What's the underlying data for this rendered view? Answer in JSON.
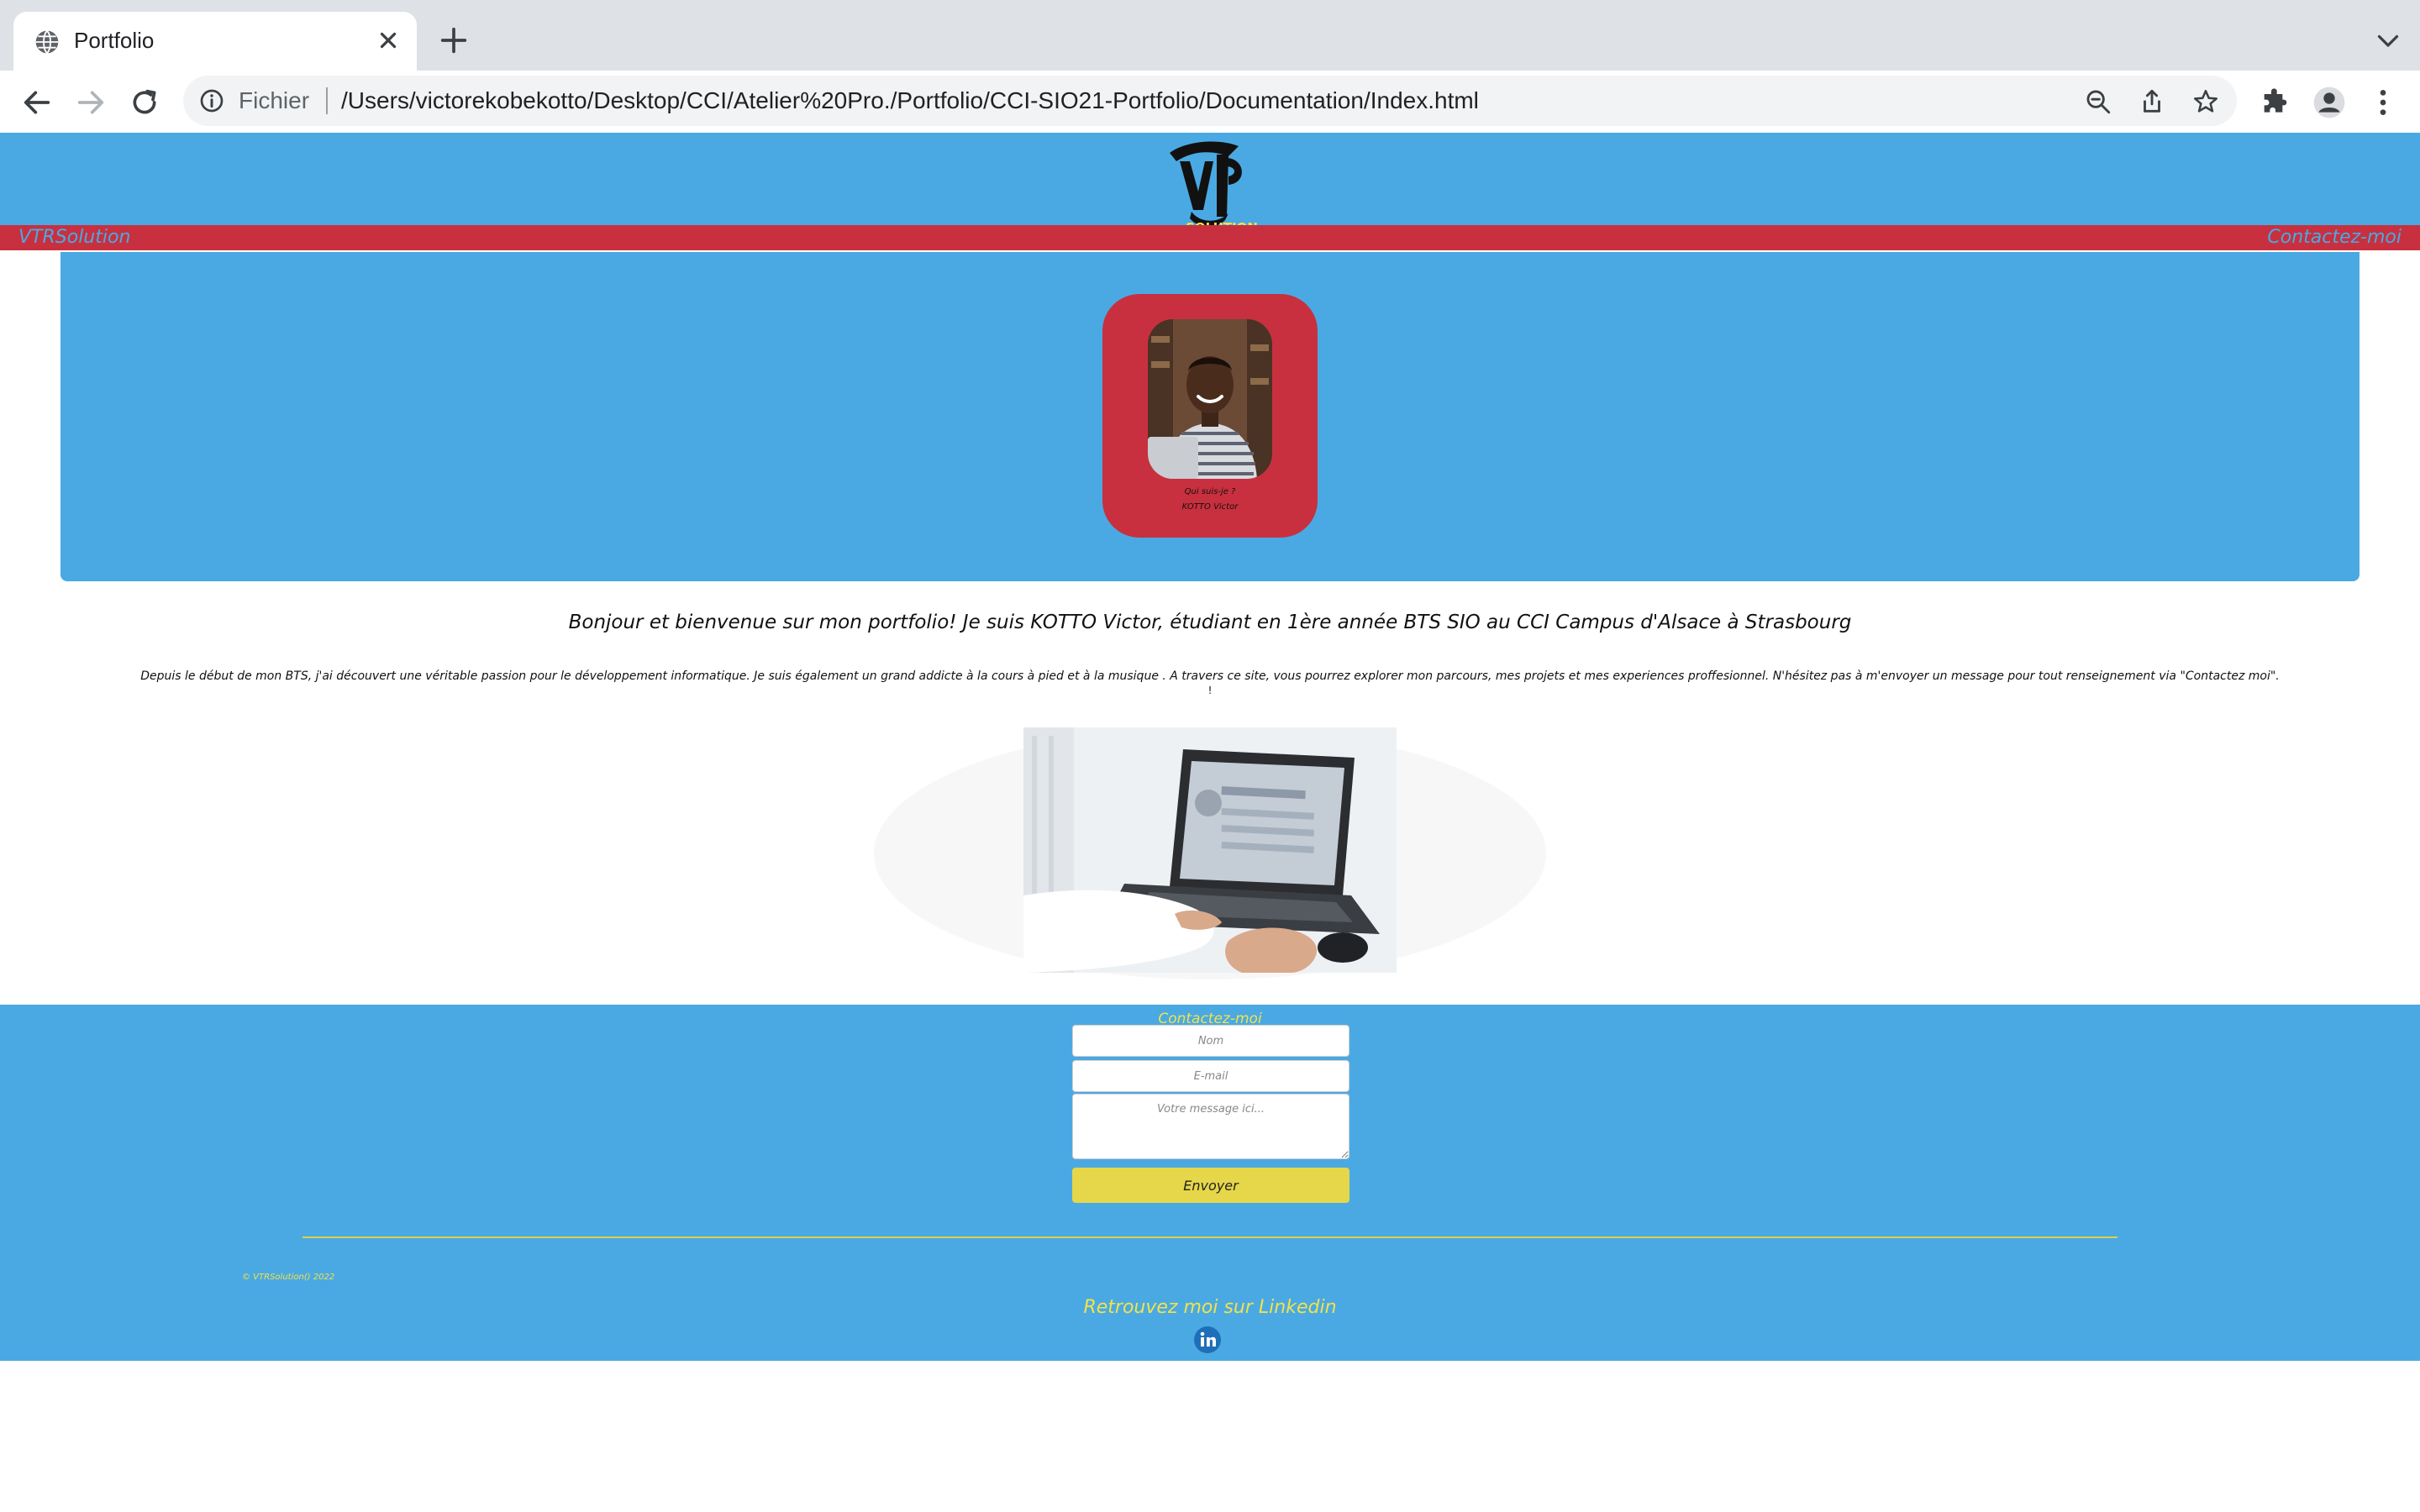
{
  "browser": {
    "tab_title": "Portfolio",
    "address_scheme": "Fichier",
    "address_url": "/Users/victorekobekotto/Desktop/CCI/Atelier%20Pro./Portfolio/CCI-SIO21-Portfolio/Documentation/Index.html"
  },
  "site": {
    "brand": "VTRSolution",
    "nav_contact": "Contactez-moi",
    "logo_text": "SOLUTION",
    "card_question": "Qui suis-je ?",
    "card_name": "KOTTO Victor",
    "welcome": "Bonjour et bienvenue sur mon portfolio! Je suis KOTTO Victor, étudiant en 1ère année BTS SIO au CCI Campus d'Alsace à Strasbourg",
    "description": "Depuis le début de mon BTS, j'ai découvert une véritable passion pour le développement informatique. Je suis également un grand addicte à la cours à pied et à la musique . A travers ce site, vous pourrez explorer mon parcours, mes projets et mes experiences proffesionnel. N'hésitez pas à m'envoyer un message pour tout renseignement via \"Contactez moi\".",
    "description_tail": "!"
  },
  "contact_form": {
    "title": "Contactez-moi",
    "name_placeholder": "Nom",
    "email_placeholder": "E-mail",
    "message_placeholder": "Votre message ici...",
    "submit_label": "Envoyer"
  },
  "footer": {
    "copyright": "© VTRSolution() 2022",
    "linkedin_text": "Retrouvez moi sur Linkedin"
  },
  "colors": {
    "primary_blue": "#4aa9e3",
    "accent_red": "#c8303f",
    "accent_yellow": "#e6d649"
  }
}
